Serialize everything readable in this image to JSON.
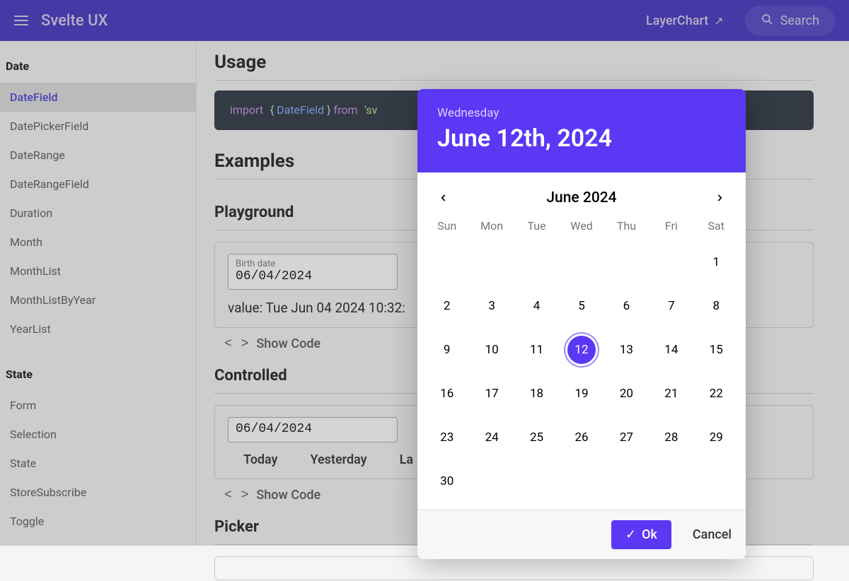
{
  "header": {
    "brand": "Svelte UX",
    "layerchart": "LayerChart",
    "search": "Search"
  },
  "sidebar": {
    "groupDate": "Date",
    "dateItems": [
      "DateField",
      "DatePickerField",
      "DateRange",
      "DateRangeField",
      "Duration",
      "Month",
      "MonthList",
      "MonthListByYear",
      "YearList"
    ],
    "groupState": "State",
    "stateItems": [
      "Form",
      "Selection",
      "State",
      "StoreSubscribe",
      "Toggle"
    ]
  },
  "main": {
    "usage": "Usage",
    "code_import": "import",
    "code_id": "DateField",
    "code_from": "from",
    "code_str": "'sv",
    "examples": "Examples",
    "playground": "Playground",
    "inputLabel": "Birth date",
    "inputValue": "06/04/2024",
    "valueLine": "value: Tue Jun 04 2024 10:32:",
    "showCode": "Show Code",
    "controlled": "Controlled",
    "controlledValue": "06/04/2024",
    "chips": [
      "Today",
      "Yesterday",
      "La"
    ],
    "picker": "Picker"
  },
  "dp": {
    "weekday": "Wednesday",
    "dateBig": "June 12th, 2024",
    "month": "June 2024",
    "dow": [
      "Sun",
      "Mon",
      "Tue",
      "Wed",
      "Thu",
      "Fri",
      "Sat"
    ],
    "weeks": [
      [
        "",
        "",
        "",
        "",
        "",
        "",
        "1"
      ],
      [
        "2",
        "3",
        "4",
        "5",
        "6",
        "7",
        "8"
      ],
      [
        "9",
        "10",
        "11",
        "12",
        "13",
        "14",
        "15"
      ],
      [
        "16",
        "17",
        "18",
        "19",
        "20",
        "21",
        "22"
      ],
      [
        "23",
        "24",
        "25",
        "26",
        "27",
        "28",
        "29"
      ],
      [
        "30",
        "",
        "",
        "",
        "",
        "",
        ""
      ]
    ],
    "selected": "12",
    "ok": "Ok",
    "cancel": "Cancel"
  }
}
